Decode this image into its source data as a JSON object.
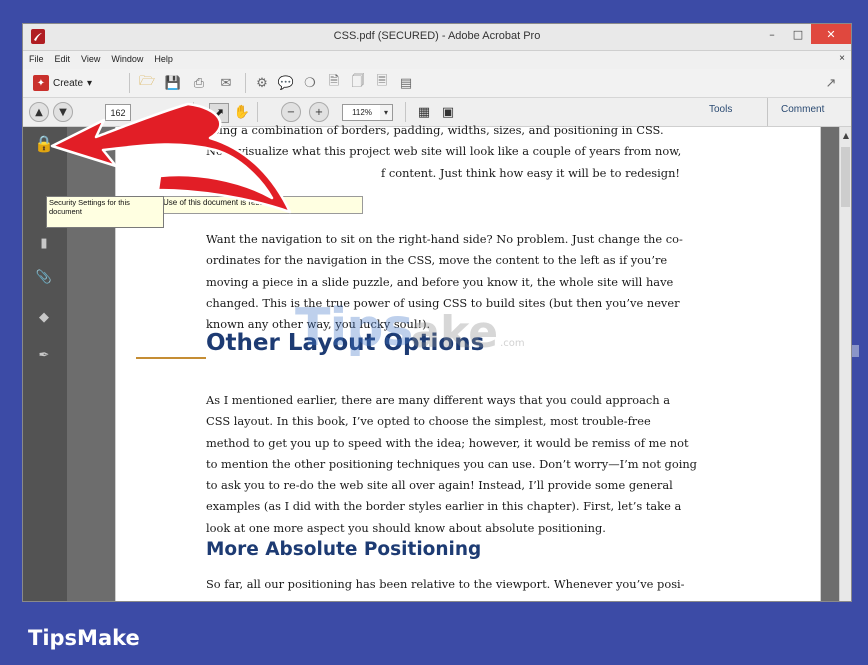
{
  "window": {
    "title": "CSS.pdf (SECURED) - Adobe Acrobat Pro",
    "controls": {
      "minimize": "–",
      "maximize": "□",
      "close": "✕"
    }
  },
  "menubar": {
    "items": [
      "File",
      "Edit",
      "View",
      "Window",
      "Help"
    ],
    "close_glyph": "×"
  },
  "toolbar": {
    "create_label": "Create",
    "create_glyph": "▾",
    "page_number": "162",
    "zoom": "112%",
    "tools_label": "Tools",
    "comment_label": "Comment"
  },
  "tooltip": {
    "left_text": "Security Settings for this document",
    "right_text": "Use of this document is restricted..."
  },
  "document": {
    "para0_line1": "using a combination of borders, padding, widths, sizes, and positioning in CSS.",
    "para0_line2": "Now, visualize what this project web site will look like a couple of years from now,",
    "para0_line3": "f content. Just think how easy it will be to redesign!",
    "para1": [
      "Want the navigation to sit on the right-hand side? No problem. Just change the co-",
      "ordinates for the navigation in the CSS, move the content to the left as if you’re",
      "moving a piece in a slide puzzle, and before you know it, the whole site will have",
      "changed. This is the true power of using CSS to build sites (but then you’ve never",
      "known any other way, you lucky soul!)."
    ],
    "heading1": "Other Layout Options",
    "para2": [
      "As I mentioned earlier, there are many different ways that you could approach a",
      "CSS layout. In this book, I’ve opted to choose the simplest, most trouble-free",
      "method to get you up to speed with the idea; however, it would be remiss of me not",
      "to mention the other positioning techniques you can use. Don’t worry—I’m not going",
      "to ask you to re-do the web site all over again! Instead, I’ll provide some general",
      "examples (as I did with the border styles earlier in this chapter). First, let’s take a",
      "look at one more aspect you should know about absolute positioning."
    ],
    "heading2": "More Absolute Positioning",
    "para3_line1": "So far, all our positioning has been relative to the viewport. Whenever you’ve posi-"
  },
  "watermark": {
    "tips": "Tips",
    "make": "ake",
    "com": ".com"
  },
  "brand": "TipsMake",
  "colors": {
    "background": "#3c4ba6",
    "arrow": "#e21e26",
    "heading": "#1d3b73",
    "close_button": "#e0483e"
  }
}
